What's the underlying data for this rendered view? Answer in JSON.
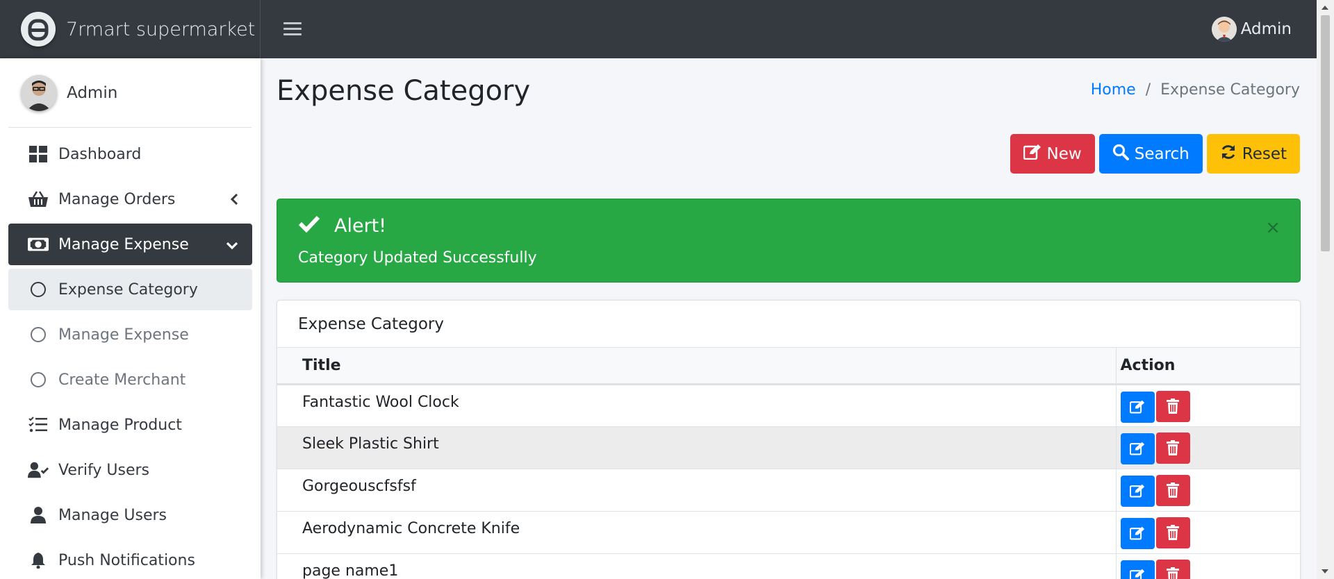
{
  "brand": {
    "name": "7rmart supermarket"
  },
  "topbar": {
    "user_name": "Admin"
  },
  "sidebar": {
    "user_name": "Admin",
    "items": [
      {
        "label": "Dashboard",
        "icon": "dashboard-icon"
      },
      {
        "label": "Manage Orders",
        "icon": "basket-icon"
      },
      {
        "label": "Manage Expense",
        "icon": "money-bill-icon"
      },
      {
        "label": "Expense Category",
        "icon": "circle-icon"
      },
      {
        "label": "Manage Expense",
        "icon": "circle-icon"
      },
      {
        "label": "Create Merchant",
        "icon": "circle-icon"
      },
      {
        "label": "Manage Product",
        "icon": "list-check-icon"
      },
      {
        "label": "Verify Users",
        "icon": "user-check-icon"
      },
      {
        "label": "Manage Users",
        "icon": "user-icon"
      },
      {
        "label": "Push Notifications",
        "icon": "bell-icon"
      }
    ]
  },
  "page": {
    "title": "Expense Category",
    "breadcrumb": {
      "home": "Home",
      "separator": "/",
      "current": "Expense Category"
    }
  },
  "toolbar": {
    "new_label": "New",
    "search_label": "Search",
    "reset_label": "Reset"
  },
  "alert": {
    "title": "Alert!",
    "message": "Category Updated Successfully",
    "close": "×"
  },
  "card": {
    "title": "Expense Category",
    "columns": [
      "Title",
      "Action"
    ],
    "rows": [
      {
        "title": "Fantastic Wool Clock"
      },
      {
        "title": "Sleek Plastic Shirt"
      },
      {
        "title": "Gorgeouscfsfsf"
      },
      {
        "title": "Aerodynamic Concrete Knife"
      },
      {
        "title": "page name1"
      }
    ]
  },
  "colors": {
    "topbar": "#343a40",
    "primary": "#007bff",
    "danger": "#dc3545",
    "warning": "#ffc107",
    "success": "#28a745"
  }
}
